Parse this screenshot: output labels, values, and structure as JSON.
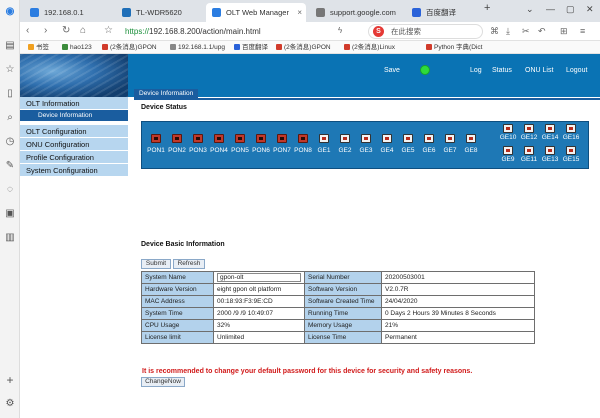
{
  "browser": {
    "tabs": [
      {
        "label": "192.168.0.1",
        "color": "#2b7de1"
      },
      {
        "label": "TL-WDR5620",
        "color": "#1f6fb8"
      },
      {
        "label": "OLT Web Manager",
        "color": "#2b7de1"
      },
      {
        "label": "support.google.com",
        "color": "#777777"
      },
      {
        "label": "百度翻译",
        "color": "#2a62d9"
      }
    ],
    "new_tab": "+",
    "address_scheme": "https://",
    "address_rest": "192.168.8.200/action/main.html",
    "search_placeholder": "在此搜索",
    "search_logo": "S",
    "bookmarks": [
      "书签",
      "hao123",
      "(2条消息)GPON",
      "192.168.1.1/upg",
      "百度翻译",
      "(2条消息)GPON",
      "(2条消息)Linux",
      "Python 字典(Dict"
    ]
  },
  "header": {
    "save": "Save",
    "status_color": "#2edb3b",
    "log": "Log",
    "status": "Status",
    "onu_list": "ONU List",
    "logout": "Logout"
  },
  "menu": {
    "olt_information": "OLT Information",
    "device_information": "Device Information",
    "olt_configuration": "OLT Configuration",
    "onu_configuration": "ONU Configuration",
    "profile_configuration": "Profile Configuration",
    "system_configuration": "System Configuration"
  },
  "breadcrumb": "Device Information",
  "device_status": {
    "title": "Device Status",
    "pon_ports": [
      "PON1",
      "PON2",
      "PON3",
      "PON4",
      "PON5",
      "PON6",
      "PON7",
      "PON8"
    ],
    "ge_ports": [
      "GE1",
      "GE2",
      "GE3",
      "GE4",
      "GE5",
      "GE6",
      "GE7",
      "GE8"
    ],
    "ge_upper": [
      "GE10",
      "GE12",
      "GE14",
      "GE16"
    ],
    "ge_lower": [
      "GE9",
      "GE11",
      "GE13",
      "GE15"
    ]
  },
  "basic": {
    "title": "Device Basic Information",
    "submit": "Submit",
    "refresh": "Refresh",
    "rows": [
      {
        "k1": "System Name",
        "v1": "gpon-olt",
        "k2": "Serial Number",
        "v2": "20200503001"
      },
      {
        "k1": "Hardware Version",
        "v1": "eight gpon olt platform",
        "k2": "Software Version",
        "v2": "V2.0.7R"
      },
      {
        "k1": "MAC Address",
        "v1": "00:18:93:F3:9E:CD",
        "k2": "Software Created Time",
        "v2": "24/04/2020"
      },
      {
        "k1": "System Time",
        "v1": "2000 /9 /9 10:49:07",
        "k2": "Running Time",
        "v2": "0 Days 2 Hours 39 Minutes 8 Seconds"
      },
      {
        "k1": "CPU Usage",
        "v1": "32%",
        "k2": "Memory Usage",
        "v2": "21%"
      },
      {
        "k1": "License limit",
        "v1": "Unlimited",
        "k2": "License Time",
        "v2": "Permanent"
      }
    ]
  },
  "warning": "It is recommended to change your default password for this device for security and safety reasons.",
  "change_now": "ChangeNow"
}
